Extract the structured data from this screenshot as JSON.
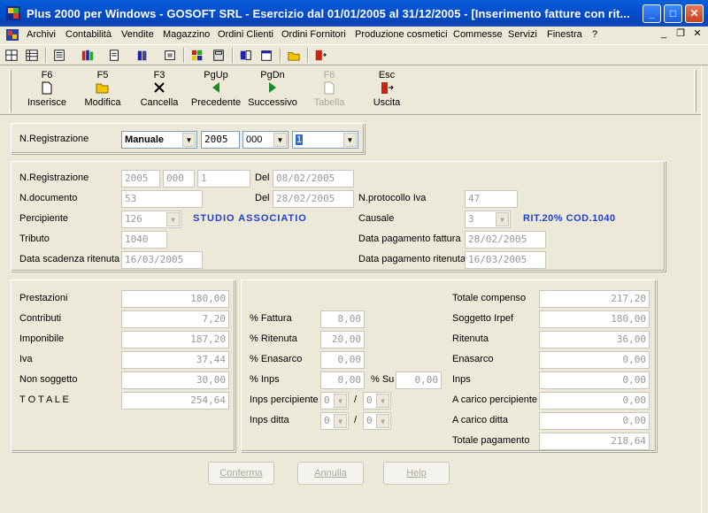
{
  "window": {
    "title": "Plus 2000 per Windows - GOSOFT SRL - Esercizio dal 01/01/2005 al 31/12/2005 - [Inserimento fatture con rit...",
    "minimize": "_",
    "maximize": "□",
    "close": "✕"
  },
  "menu": {
    "items": [
      "Archivi",
      "Contabilità",
      "Vendite",
      "Magazzino",
      "Ordini Clienti",
      "Ordini Fornitori",
      "Produzione cosmetici",
      "Commesse",
      "Servizi",
      "Finestra",
      "?"
    ],
    "mdi": {
      "minimize": "_",
      "restore": "❐",
      "close": "✕"
    }
  },
  "toolbar": {
    "buttons": [
      {
        "key": "F6",
        "label": "Inserisce",
        "icon": "new-document-icon",
        "glyph": "🗋"
      },
      {
        "key": "F5",
        "label": "Modifica",
        "icon": "open-folder-icon",
        "glyph": "📂"
      },
      {
        "key": "F3",
        "label": "Cancella",
        "icon": "delete-x-icon",
        "glyph": "✕"
      },
      {
        "key": "PgUp",
        "label": "Precedente",
        "icon": "arrow-left-icon",
        "glyph": "◀"
      },
      {
        "key": "PgDn",
        "label": "Successivo",
        "icon": "arrow-right-icon",
        "glyph": "▶"
      },
      {
        "key": "F6",
        "label": "Tabella",
        "icon": "table-document-icon",
        "glyph": "🗋"
      },
      {
        "key": "Esc",
        "label": "Uscita",
        "icon": "exit-door-icon",
        "glyph": "🚪"
      }
    ]
  },
  "search": {
    "label": "N.Registrazione",
    "mode": "Manuale",
    "year": "2005",
    "series": "000",
    "number": "1"
  },
  "header": {
    "nreg_label": "N.Registrazione",
    "nreg_year": "2005",
    "nreg_series": "000",
    "nreg_number": "1",
    "del1_label": "Del",
    "del1_value": "08/02/2005",
    "ndoc_label": "N.documento",
    "ndoc_value": "53",
    "del2_label": "Del",
    "del2_value": "28/02/2005",
    "nprot_label": "N.protocollo Iva",
    "nprot_value": "47",
    "percipiente_label": "Percipiente",
    "percipiente_code": "126",
    "percipiente_name": "STUDIO ASSOCIATIO",
    "causale_label": "Causale",
    "causale_code": "3",
    "causale_desc": "RIT.20% COD.1040",
    "tributo_label": "Tributo",
    "tributo_value": "1040",
    "dpf_label": "Data pagamento fattura",
    "dpf_value": "28/02/2005",
    "dsr_label": "Data scadenza ritenuta",
    "dsr_value": "16/03/2005",
    "dpr_label": "Data pagamento ritenuta",
    "dpr_value": "16/03/2005"
  },
  "left_totals": [
    {
      "label": "Prestazioni",
      "value": "180,00"
    },
    {
      "label": "Contributi",
      "value": "7,20"
    },
    {
      "label": "Imponibile",
      "value": "187,20"
    },
    {
      "label": "Iva",
      "value": "37,44"
    },
    {
      "label": "Non soggetto",
      "value": "30,00"
    },
    {
      "label": "T O T A L E",
      "value": "254,64"
    }
  ],
  "percentages": {
    "fattura_label": "% Fattura",
    "fattura_value": "0,00",
    "ritenuta_label": "% Ritenuta",
    "ritenuta_value": "20,00",
    "enasarco_label": "% Enasarco",
    "enasarco_value": "0,00",
    "inps_label": "% Inps",
    "inps_value": "0,00",
    "su_label": "% Su",
    "su_value": "0,00",
    "inps_perc_label": "Inps percipiente",
    "inps_perc_a": "0",
    "inps_perc_b": "0",
    "inps_ditta_label": "Inps ditta",
    "inps_ditta_a": "0",
    "inps_ditta_b": "0",
    "slash": "/"
  },
  "right_totals": [
    {
      "label": "Totale compenso",
      "value": "217,20"
    },
    {
      "label": "Soggetto Irpef",
      "value": "180,00"
    },
    {
      "label": "Ritenuta",
      "value": "36,00"
    },
    {
      "label": "Enasarco",
      "value": "0,00"
    },
    {
      "label": "Inps",
      "value": "0,00"
    },
    {
      "label": "A carico percipiente",
      "value": "0,00"
    },
    {
      "label": "A carico ditta",
      "value": "0,00"
    },
    {
      "label": "Totale pagamento",
      "value": "218,64"
    }
  ],
  "actions": {
    "confirm": "Conferma",
    "cancel": "Annulla",
    "help": "Help"
  }
}
